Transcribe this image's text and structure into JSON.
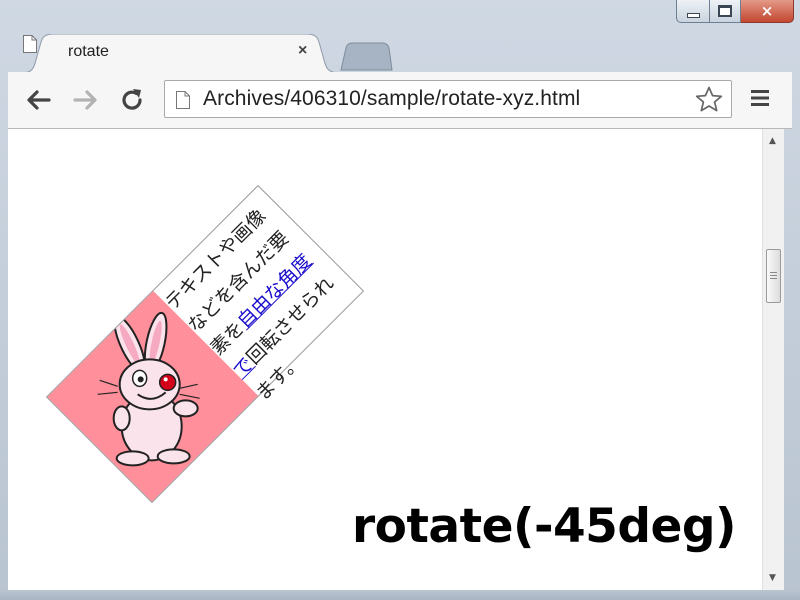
{
  "window": {
    "minimize_icon": "minimize-icon",
    "maximize_icon": "maximize-icon",
    "close_glyph": "×",
    "close_color": "#c3462f"
  },
  "tabs": [
    {
      "title": "rotate",
      "close": "×",
      "active": true
    }
  ],
  "toolbar": {
    "back_icon": "back-arrow-icon",
    "forward_icon": "forward-arrow-icon",
    "reload_icon": "reload-icon",
    "url": "Archives/406310/sample/rotate-xyz.html",
    "bookmark_icon": "star-icon",
    "menu_icon": "hamburger-menu-icon"
  },
  "page": {
    "demo_text_before": "テキストや画像などを含んだ要素を",
    "demo_link": "自由な角度で",
    "demo_text_after": "回転させられます。",
    "rotation_deg": -45,
    "panel_color": "#ff8f9a",
    "image_icon": "rabbit-image",
    "caption": "rotate(-45deg)"
  },
  "scrollbar": {
    "up_icon": "▲",
    "down_icon": "▼"
  }
}
